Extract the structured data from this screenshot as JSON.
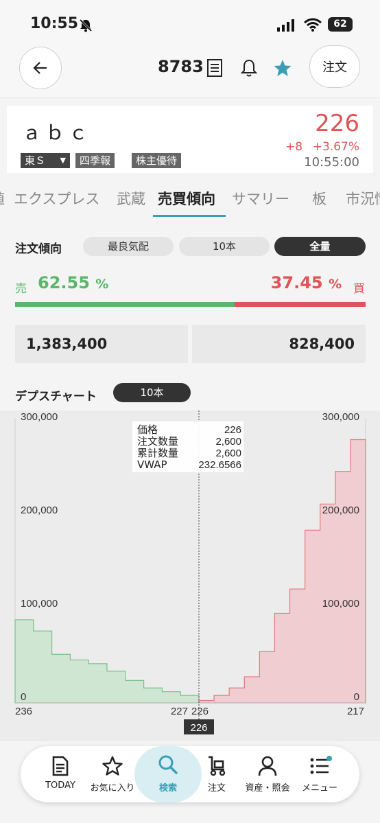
{
  "status": {
    "time": "10:55",
    "battery": "62"
  },
  "header": {
    "code": "8783",
    "order_label": "注文"
  },
  "stock": {
    "name": "ａｂｃ",
    "price": "226",
    "change": "+8",
    "change_pct": "+3.67%",
    "time": "10:55:00",
    "market": "東Ｓ",
    "badges": [
      "四季報",
      "株主優待"
    ]
  },
  "tabs": [
    "値",
    "エクスプレス",
    "武蔵",
    "売買傾向",
    "サマリー",
    "板",
    "市況情"
  ],
  "order_trend": {
    "label": "注文傾向",
    "options": [
      "最良気配",
      "10本",
      "全量"
    ],
    "selected": "全量",
    "sell_label": "売",
    "sell_pct": "62.55",
    "buy_label": "買",
    "buy_pct": "37.45",
    "pct_unit": "%",
    "sell_volume": "1,383,400",
    "buy_volume": "828,400"
  },
  "depth_chart": {
    "label": "デプスチャート",
    "option": "10本"
  },
  "chart_data": {
    "type": "area",
    "left_axis": [
      "300,000",
      "200,000",
      "100,000",
      "0"
    ],
    "right_axis": [
      "300,000",
      "200,000",
      "100,000",
      "0"
    ],
    "x_labels": {
      "left_start": "236",
      "left_end": "227",
      "center": "226",
      "right_end": "217",
      "cursor": "226"
    },
    "ylim": [
      0,
      300000
    ],
    "sell_series": {
      "prices": [
        236,
        235,
        234,
        233,
        232,
        231,
        230,
        229,
        228,
        227
      ],
      "cumulative": [
        89000,
        77000,
        52000,
        46000,
        42000,
        34000,
        24000,
        16000,
        12000,
        8000
      ]
    },
    "buy_series": {
      "prices": [
        226,
        225,
        224,
        223,
        222,
        221,
        220,
        219,
        218,
        217
      ],
      "cumulative": [
        2600,
        8000,
        16000,
        28000,
        55000,
        96000,
        122000,
        185000,
        213000,
        248000,
        282000
      ]
    },
    "tooltip": {
      "rows": [
        {
          "label": "価格",
          "value": "226"
        },
        {
          "label": "注文数量",
          "value": "2,600"
        },
        {
          "label": "累計数量",
          "value": "2,600"
        },
        {
          "label": "VWAP",
          "value": "232.6566"
        }
      ]
    }
  },
  "nav": [
    {
      "label": "TODAY",
      "icon": "document-icon"
    },
    {
      "label": "お気に入り",
      "icon": "star-icon"
    },
    {
      "label": "検索",
      "icon": "search-icon",
      "active": true
    },
    {
      "label": "注文",
      "icon": "cart-icon"
    },
    {
      "label": "資産・照会",
      "icon": "person-icon"
    },
    {
      "label": "メニュー",
      "icon": "menu-icon"
    }
  ],
  "colors": {
    "green": "#5bb66a",
    "red": "#e05356",
    "teal": "#3a9fb5"
  }
}
